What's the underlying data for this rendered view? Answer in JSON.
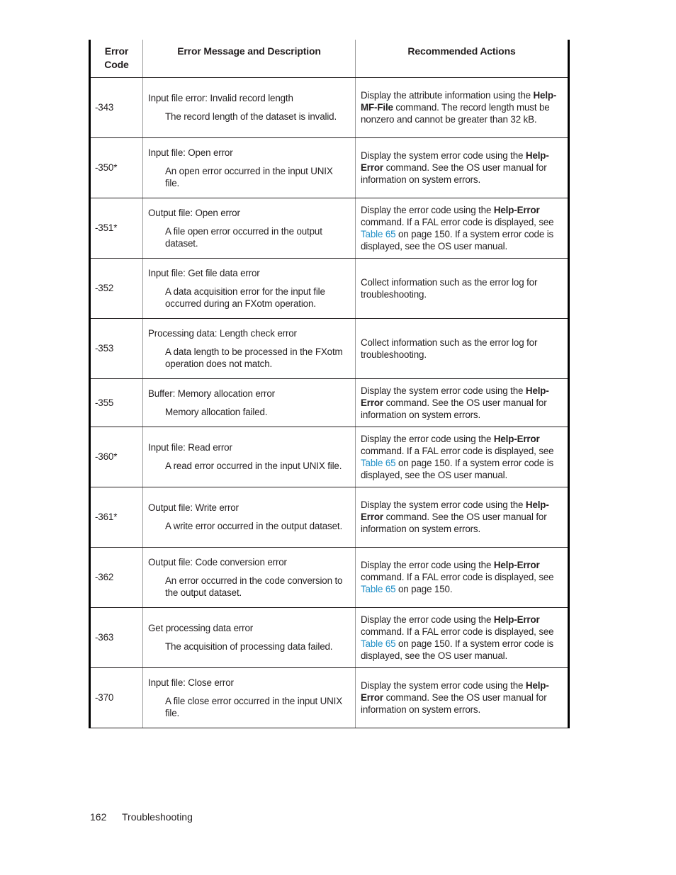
{
  "table": {
    "headers": {
      "code": "Error Code",
      "message": "Error Message and Description",
      "actions": "Recommended Actions"
    },
    "rows": [
      {
        "code": "-343",
        "title": "Input file error: Invalid record length",
        "description": "The record length of the dataset is invalid.",
        "action": {
          "pre": "Display the attribute information using the ",
          "bold": "Help-MF-File",
          "post": " command. The record length must be nonzero and cannot be greater than 32 kB.",
          "link": "",
          "tail": ""
        }
      },
      {
        "code": "-350*",
        "title": "Input file: Open error",
        "description": "An open error occurred in the input UNIX file.",
        "action": {
          "pre": "Display the system error code using the ",
          "bold": "Help-Error",
          "post": " command. See the OS user manual for information on system errors.",
          "link": "",
          "tail": ""
        }
      },
      {
        "code": "-351*",
        "title": "Output file: Open error",
        "description": "A file open error occurred in the output dataset.",
        "action": {
          "pre": "Display the error code using the ",
          "bold": "Help-Error",
          "post": " command. If a FAL error code is displayed, see ",
          "link": "Table 65",
          "tail": " on page 150. If a system error code is displayed, see the OS user manual."
        }
      },
      {
        "code": "-352",
        "title": "Input file: Get file data error",
        "description": "A data acquisition error for the input file occurred during an FXotm operation.",
        "action": {
          "pre": "Collect information such as the error log for troubleshooting.",
          "bold": "",
          "post": "",
          "link": "",
          "tail": ""
        }
      },
      {
        "code": "-353",
        "title": "Processing data: Length check error",
        "description": "A data length to be processed in the FXotm operation does not match.",
        "action": {
          "pre": "Collect information such as the error log for troubleshooting.",
          "bold": "",
          "post": "",
          "link": "",
          "tail": ""
        }
      },
      {
        "code": "-355",
        "title": "Buffer: Memory allocation error",
        "description": "Memory allocation failed.",
        "action": {
          "pre": "Display the system error code using the ",
          "bold": "Help-Error",
          "post": " command. See the OS user manual for information on system errors.",
          "link": "",
          "tail": ""
        }
      },
      {
        "code": "-360*",
        "title": "Input file: Read error",
        "description": "A read error occurred in the input UNIX file.",
        "action": {
          "pre": "Display the error code using the ",
          "bold": "Help-Error",
          "post": " command. If a FAL error code is displayed, see ",
          "link": "Table 65",
          "tail": " on page 150. If a system error code is displayed, see the OS user manual."
        }
      },
      {
        "code": "-361*",
        "title": "Output file: Write error",
        "description": "A write error occurred in the output dataset.",
        "action": {
          "pre": "Display the system error code using the ",
          "bold": "Help-Error",
          "post": " command. See the OS user manual for information on system errors.",
          "link": "",
          "tail": ""
        }
      },
      {
        "code": "-362",
        "title": "Output file: Code conversion error",
        "description": "An error occurred in the code conversion to the output dataset.",
        "action": {
          "pre": "Display the error code using the ",
          "bold": "Help-Error",
          "post": " command. If a FAL error code is displayed, see ",
          "link": "Table 65",
          "tail": " on page 150."
        }
      },
      {
        "code": "-363",
        "title": "Get processing data error",
        "description": "The acquisition of processing data failed.",
        "action": {
          "pre": "Display the error code using the ",
          "bold": "Help-Error",
          "post": " command. If a FAL error code is displayed, see ",
          "link": "Table 65",
          "tail": " on page 150. If a system error code is displayed, see the OS user manual."
        }
      },
      {
        "code": "-370",
        "title": "Input file: Close error",
        "description": "A file close error occurred in the input UNIX file.",
        "action": {
          "pre": "Display the system error code using the ",
          "bold": "Help-Error",
          "post": " command. See the OS user manual for information on system errors.",
          "link": "",
          "tail": ""
        }
      }
    ]
  },
  "footer": {
    "page_number": "162",
    "section": "Troubleshooting"
  },
  "colors": {
    "link": "#1f8fc7",
    "text": "#231f20"
  }
}
